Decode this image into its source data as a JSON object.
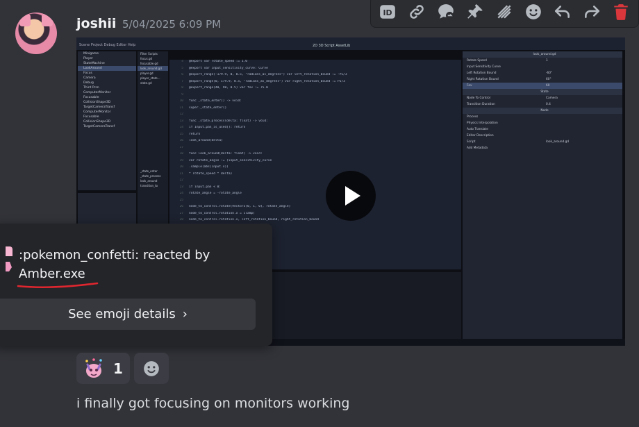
{
  "message": {
    "author": "joshii",
    "timestamp": "5/04/2025 6:09 PM",
    "text": "i finally got focusing on monitors working"
  },
  "toolbar": {
    "buttons": [
      "app-id-icon",
      "copy-link-icon",
      "reply-thread-icon",
      "pin-icon",
      "format-icon",
      "emoji-icon",
      "reply-icon",
      "forward-icon",
      "delete-icon"
    ],
    "delete_color": "#da373c"
  },
  "reaction": {
    "emoji_name": "pokemon_confetti",
    "count": "1"
  },
  "reaction_popup": {
    "line1": ":pokemon_confetti: reacted by",
    "user": "Amber.exe",
    "details_button": "See emoji details",
    "underline_color": "#e0262f"
  },
  "video": {
    "play_icon": "play-icon",
    "menu": "Scene  Project  Debug  Editor  Help",
    "center_tabs": "2D   3D   Script   AssetLib",
    "scene_tree": [
      "Minigame",
      "Player",
      "StateMachine",
      "LookAround",
      "Focus",
      "Camera",
      "Debug",
      "Third Prsn",
      "ComputerMonitor",
      "Focusable",
      "CollisionShape3D",
      "TargetCameraTransf",
      "ComputerMonitor",
      "Focusable",
      "CollisionShape3D",
      "TargetCameraTransf"
    ],
    "scripts": [
      "Filter Scripts",
      "focus.gd",
      "focusable.gd",
      "look_around.gd",
      "player.gd",
      "player_state...",
      "state.gd"
    ],
    "methods": [
      "_state_enter",
      "_state_process",
      "look_around",
      "transition_to"
    ],
    "code": [
      "@export var rotate_speed := 1.0",
      "@export var input_sensitivity_curve: Curve",
      "@export_range(-179.9, 0, 0.5, \"radians_as_degrees\") var left_rotation_bound := -PI/3",
      "@export_range(0, 179.9, 0.5, \"radians_as_degrees\") var right_rotation_bound := PI/3",
      "@export_range(40, 90, 0.5) var fov := 75.0",
      "",
      "func _state_enter() -> void:",
      "    super._state_enter()",
      "",
      "func _state_process(delta: float) -> void:",
      "    if Input.pan_is_used(): return",
      "        return",
      "    look_around(delta)",
      "",
      "func look_around(delta: float) -> void:",
      "    var rotate_angle := (input_sensitivity_curve",
      "        .sample(abs(input.x))",
      "        * rotate_speed * delta)",
      "",
      "    if input.pan < 0:",
      "        rotate_angle = -rotate_angle",
      "",
      "    node_to_control.rotate(Vector3(0, 1, 0), rotate_angle)",
      "    node_to_control.rotation.x = clamp(",
      "        node_to_control.rotation.x, left_rotation_bound, right_rotation_bound",
      "    )"
    ],
    "inspector": [
      {
        "label": "look_around.gd",
        "value": "",
        "kind": "hdr"
      },
      {
        "label": "Rotate Speed",
        "value": "1"
      },
      {
        "label": "Input Sensitivity Curve",
        "value": ""
      },
      {
        "label": "Left Rotation Bound",
        "value": "-60°"
      },
      {
        "label": "Right Rotation Bound",
        "value": "60°"
      },
      {
        "label": "Fov",
        "value": "60",
        "kind": "hl"
      },
      {
        "label": "State",
        "value": "",
        "kind": "hdr"
      },
      {
        "label": "Node To Control",
        "value": "Camera"
      },
      {
        "label": "Transition Duration",
        "value": "0.4"
      },
      {
        "label": "Node",
        "value": "",
        "kind": "hdr"
      },
      {
        "label": "Process",
        "value": ""
      },
      {
        "label": "Physics Interpolation",
        "value": ""
      },
      {
        "label": "Auto Translate",
        "value": ""
      },
      {
        "label": "Editor Description",
        "value": ""
      },
      {
        "label": "Script",
        "value": "look_around.gd"
      },
      {
        "label": "Add Metadata",
        "value": ""
      }
    ]
  }
}
